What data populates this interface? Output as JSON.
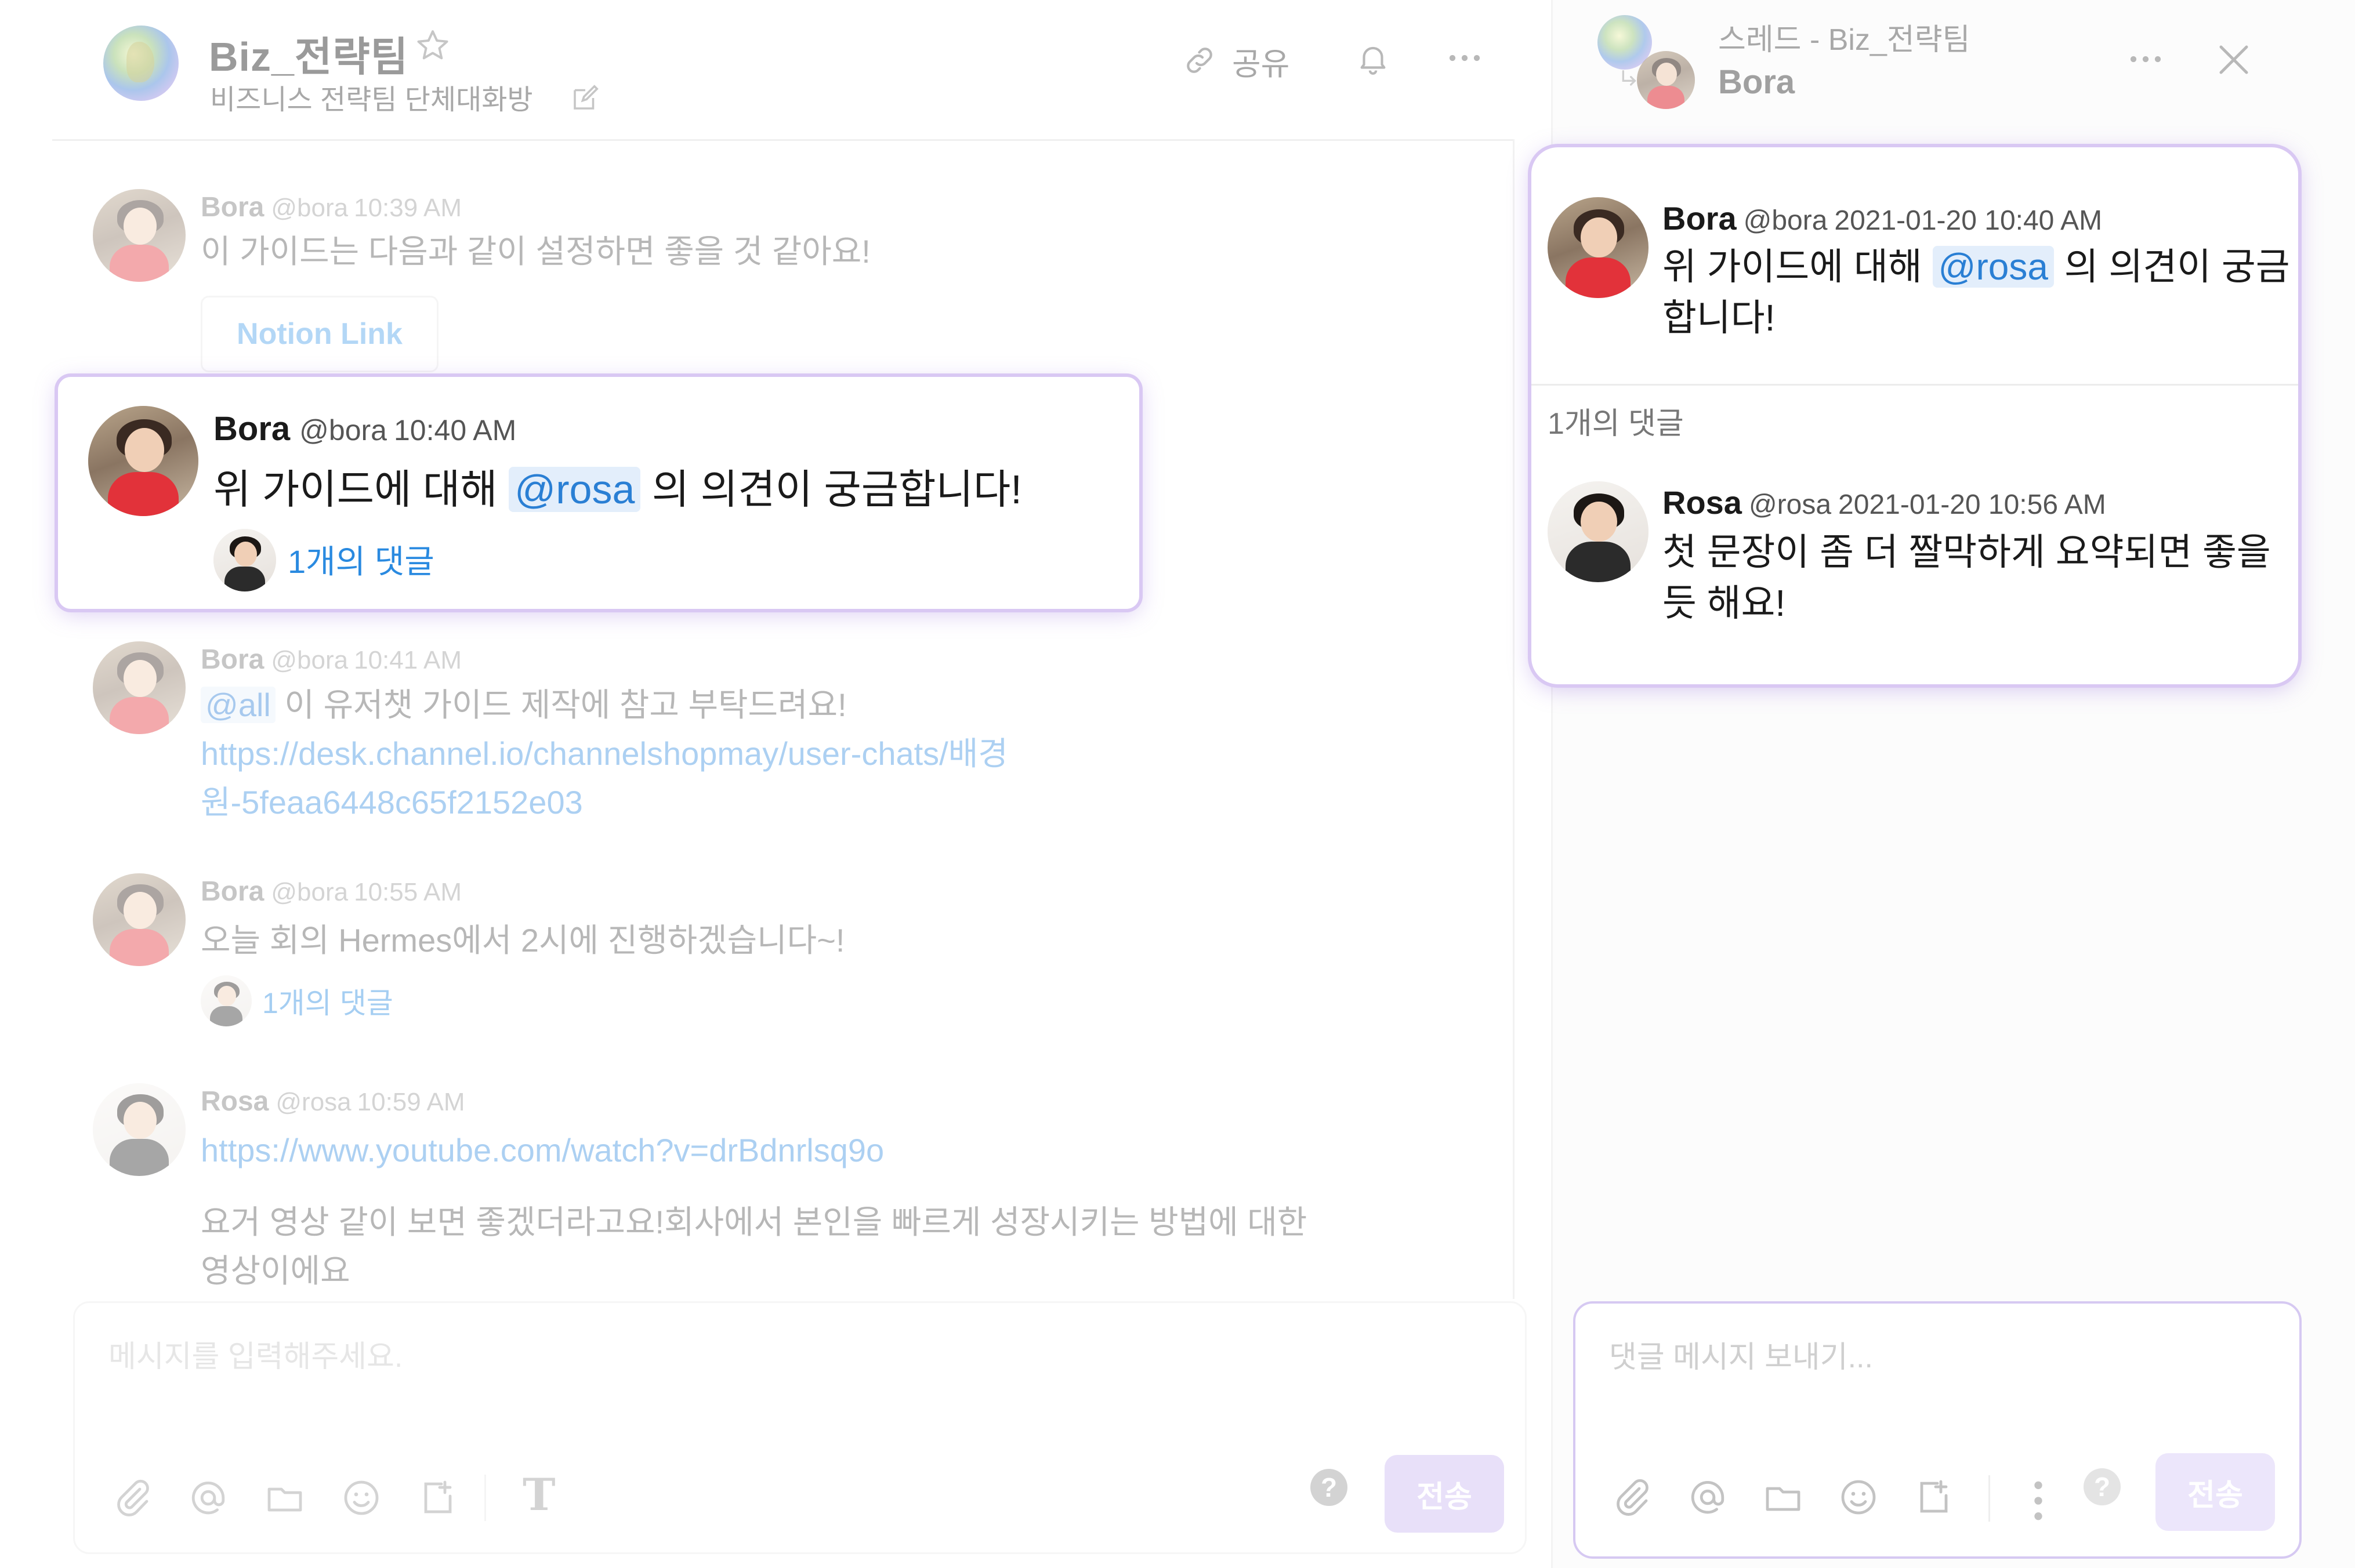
{
  "channel": {
    "title": "Biz_전략팀",
    "description": "비즈니스 전략팀 단체대화방",
    "share_label": "공유"
  },
  "messages": [
    {
      "name": "Bora",
      "handle": "@bora",
      "time": "10:39 AM",
      "text": "이 가이드는 다음과 같이 설정하면 좋을 것 같아요!",
      "button": "Notion Link"
    },
    {
      "name": "Bora",
      "handle": "@bora",
      "time": "10:40 AM",
      "text_before": "위 가이드에 대해 ",
      "mention": "@rosa",
      "text_after": " 의 의견이 궁금합니다!",
      "replies": "1개의 댓글"
    },
    {
      "name": "Bora",
      "handle": "@bora",
      "time": "10:41 AM",
      "mention": "@all",
      "text_after": " 이 유저챗 가이드 제작에 참고 부탁드려요!",
      "link_line1": "https://desk.channel.io/channelshopmay/user-chats/배경",
      "link_line2": "원-5feaa6448c65f2152e03"
    },
    {
      "name": "Bora",
      "handle": "@bora",
      "time": "10:55 AM",
      "text": "오늘 회의 Hermes에서 2시에 진행하겠습니다~!",
      "replies": "1개의 댓글"
    },
    {
      "name": "Rosa",
      "handle": "@rosa",
      "time": "10:59 AM",
      "link": "https://www.youtube.com/watch?v=drBdnrlsq9o",
      "text_line1": "요거 영상 같이 보면 좋겠더라고요!회사에서 본인을 빠르게 성장시키는 방법에 대한",
      "text_line2": "영상이에요"
    }
  ],
  "composer": {
    "placeholder": "메시지를 입력해주세요.",
    "send_label": "전송",
    "help": "?",
    "text_icon": "T"
  },
  "thread": {
    "title": "스레드 - Biz_전략팀",
    "subtitle": "Bora",
    "parent": {
      "name": "Bora",
      "handle": "@bora",
      "time": "2021-01-20 10:40 AM",
      "text_before": "위 가이드에 대해 ",
      "mention": "@rosa",
      "text_after": " 의 의견이 궁금",
      "text_line2": "합니다!"
    },
    "count_label": "1개의 댓글",
    "reply": {
      "name": "Rosa",
      "handle": "@rosa",
      "time": "2021-01-20 10:56 AM",
      "text_line1": "첫 문장이 좀 더 짤막하게 요약되면 좋을",
      "text_line2": "듯 해요!"
    },
    "composer_placeholder": "댓글 메시지 보내기...",
    "send_label": "전송",
    "help": "?"
  },
  "colors": {
    "accent_link": "#2a8ae0",
    "highlight_glow": "#d9c8f3",
    "mention_bg": "#e3eefb",
    "send_bg": "#ece6fb"
  },
  "icons": [
    "globe-icon",
    "star-icon",
    "edit-icon",
    "link-icon",
    "bell-icon",
    "more-icon",
    "close-icon",
    "attach-icon",
    "at-icon",
    "folder-icon",
    "emoji-icon",
    "export-icon",
    "text-format-icon",
    "help-icon",
    "kebab-icon"
  ]
}
